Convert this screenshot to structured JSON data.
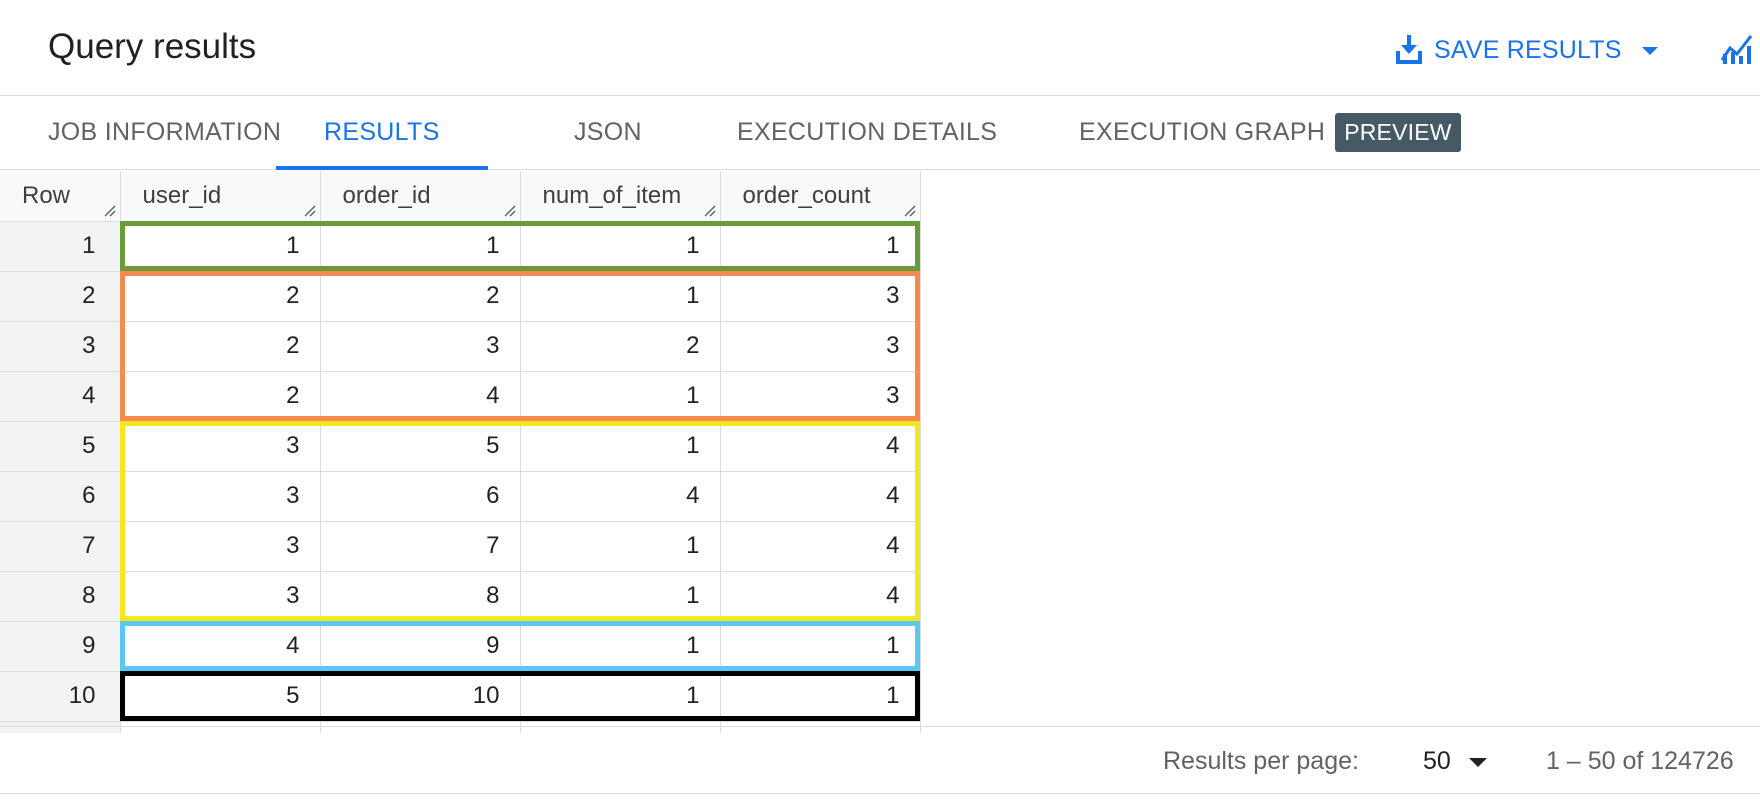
{
  "header": {
    "title": "Query results",
    "save_label": "SAVE RESULTS",
    "accent_color": "#1a73e8"
  },
  "tabs": [
    {
      "label": "JOB INFORMATION",
      "active": false
    },
    {
      "label": "RESULTS",
      "active": true
    },
    {
      "label": "JSON",
      "active": false
    },
    {
      "label": "EXECUTION DETAILS",
      "active": false
    },
    {
      "label": "EXECUTION GRAPH",
      "active": false,
      "badge": "PREVIEW"
    }
  ],
  "grid": {
    "columns": [
      "Row",
      "user_id",
      "order_id",
      "num_of_item",
      "order_count"
    ],
    "rows": [
      [
        "1",
        "1",
        "1",
        "1",
        "1"
      ],
      [
        "2",
        "2",
        "2",
        "1",
        "3"
      ],
      [
        "3",
        "2",
        "3",
        "2",
        "3"
      ],
      [
        "4",
        "2",
        "4",
        "1",
        "3"
      ],
      [
        "5",
        "3",
        "5",
        "1",
        "4"
      ],
      [
        "6",
        "3",
        "6",
        "4",
        "4"
      ],
      [
        "7",
        "3",
        "7",
        "1",
        "4"
      ],
      [
        "8",
        "3",
        "8",
        "1",
        "4"
      ],
      [
        "9",
        "4",
        "9",
        "1",
        "1"
      ],
      [
        "10",
        "5",
        "10",
        "1",
        "1"
      ]
    ],
    "highlight_groups": [
      {
        "rows": [
          1,
          1
        ],
        "color": "#6a9a3a"
      },
      {
        "rows": [
          2,
          4
        ],
        "color": "#f58b4f"
      },
      {
        "rows": [
          5,
          8
        ],
        "color": "#f5e61f"
      },
      {
        "rows": [
          9,
          9
        ],
        "color": "#5ac8f0"
      },
      {
        "rows": [
          10,
          10
        ],
        "color": "#000000"
      }
    ]
  },
  "footer": {
    "per_page_label": "Results per page:",
    "per_page_value": "50",
    "range": "1 – 50 of 124726"
  }
}
